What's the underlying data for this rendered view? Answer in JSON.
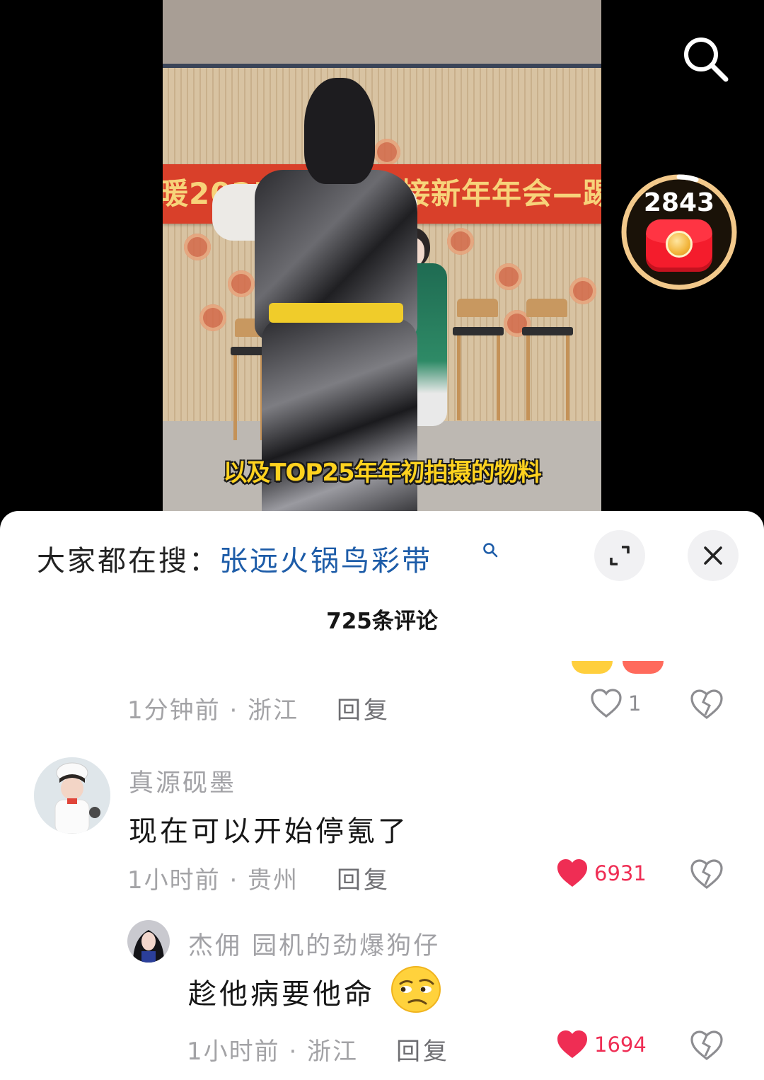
{
  "video": {
    "banner_left": "暖2025\"炉",
    "banner_right": "接新年年会—踢",
    "caption": "以及TOP25年年初拍摄的物料"
  },
  "overlay": {
    "red_packet_count": "2843",
    "red_packet_progress": 0.05
  },
  "sheet": {
    "hot_search_label": "大家都在搜：",
    "hot_search_term": "张远火锅鸟彩带",
    "comment_count": "725条评论"
  },
  "comments": [
    {
      "meta": "1分钟前 · 浙江",
      "reply": "回复",
      "likes": "1",
      "liked": false
    },
    {
      "username": "真源砚墨",
      "text": "现在可以开始停氪了",
      "meta": "1小时前 · 贵州",
      "reply": "回复",
      "likes": "6931",
      "liked": true
    },
    {
      "username": "杰佣 园机的劲爆狗仔",
      "text": "趁他病要他命",
      "emoji": "smirk-emoji",
      "meta": "1小时前 · 浙江",
      "reply": "回复",
      "likes": "1694",
      "liked": true
    }
  ],
  "colors": {
    "accent_link": "#1d5ca8",
    "like_red": "#ef2d54",
    "red_packet": "#f41c2c"
  }
}
